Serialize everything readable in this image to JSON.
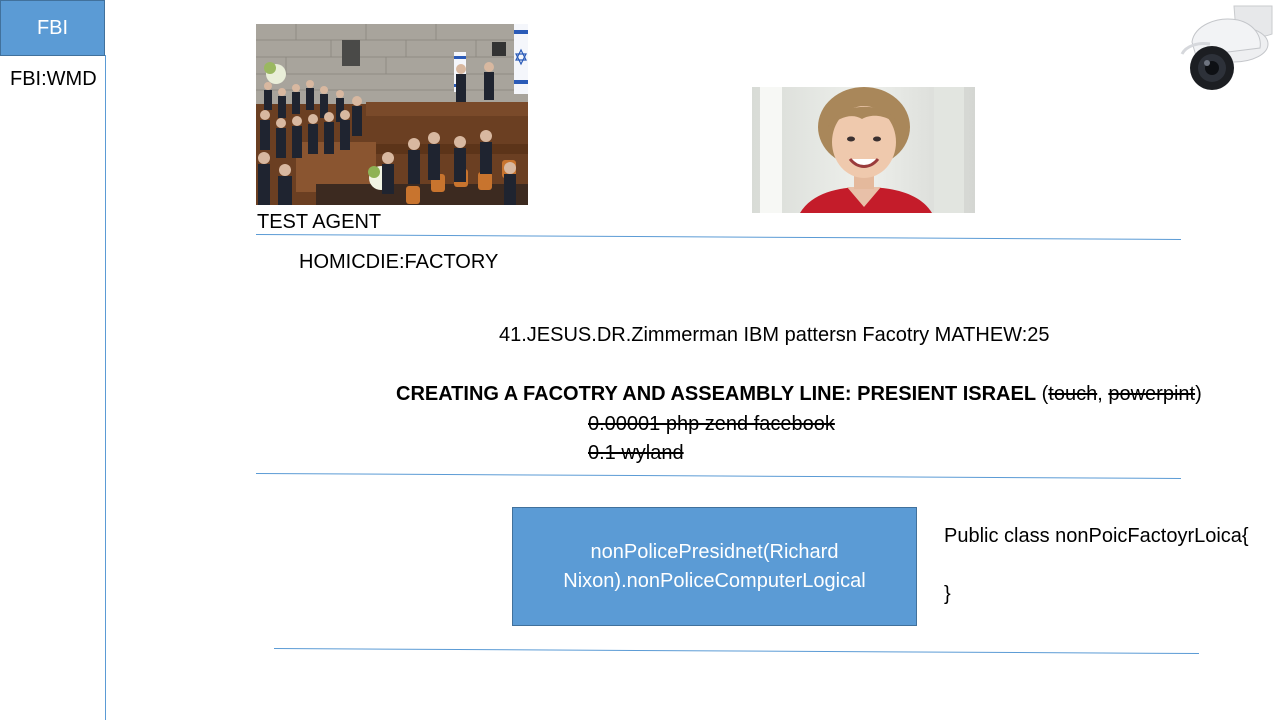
{
  "sidebar": {
    "tab_label": "FBI",
    "subtitle": "FBI:WMD"
  },
  "images": {
    "knesset": "knesset-assembly-photo",
    "portrait": "portrait-photo",
    "camera": "security-camera-icon"
  },
  "content": {
    "test_agent": "TEST AGENT",
    "homicide": "HOMICDIE:FACTORY",
    "jesus_line": "41.JESUS.DR.Zimmerman IBM pattersn Facotry MATHEW:25",
    "creating_bold": "CREATING A FACOTRY  AND ASSEAMBLY LINE: PRESIENT ISRAEL",
    "creating_open_paren": " (",
    "creating_strike_1": "touch",
    "creating_comma": ", ",
    "creating_strike_2": "powerpint",
    "creating_close_paren": ")",
    "php_line": "0.00001 php zend facebook",
    "wyland_line": "0.1 wyland"
  },
  "box": {
    "line1": "nonPolicePresidnet(Richard",
    "line2": "Nixon).nonPoliceComputerLogical"
  },
  "code": {
    "open": "Public class nonPoicFactoyrLoica{",
    "close": "}"
  },
  "colors": {
    "accent": "#5b9bd5",
    "accent_border": "#41719c"
  }
}
